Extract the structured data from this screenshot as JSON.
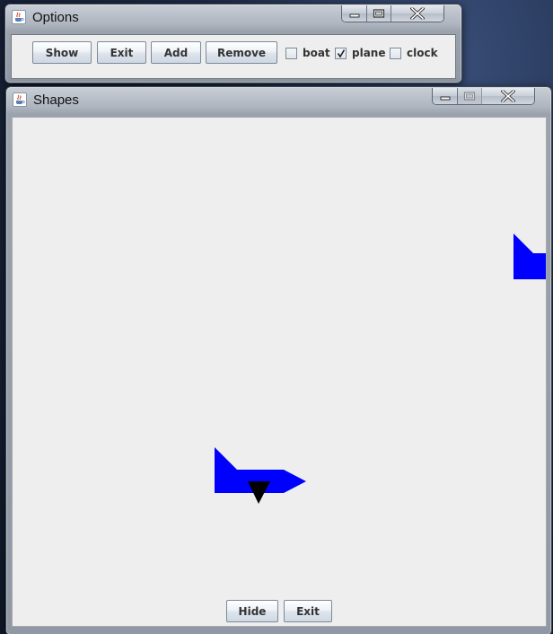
{
  "options_window": {
    "title": "Options",
    "buttons": {
      "show": "Show",
      "exit": "Exit",
      "add": "Add",
      "remove": "Remove"
    },
    "checkboxes": [
      {
        "label": "boat",
        "checked": false
      },
      {
        "label": "plane",
        "checked": true
      },
      {
        "label": "clock",
        "checked": false
      }
    ]
  },
  "shapes_window": {
    "title": "Shapes",
    "buttons": {
      "hide": "Hide",
      "exit": "Exit"
    },
    "shape_color": "#0000ff",
    "marker_color": "#000000"
  },
  "icons": {
    "app": "java-coffee-icon",
    "minimize": "minimize-icon",
    "maximize": "maximize-icon",
    "close": "close-icon",
    "check": "checkmark-icon"
  }
}
